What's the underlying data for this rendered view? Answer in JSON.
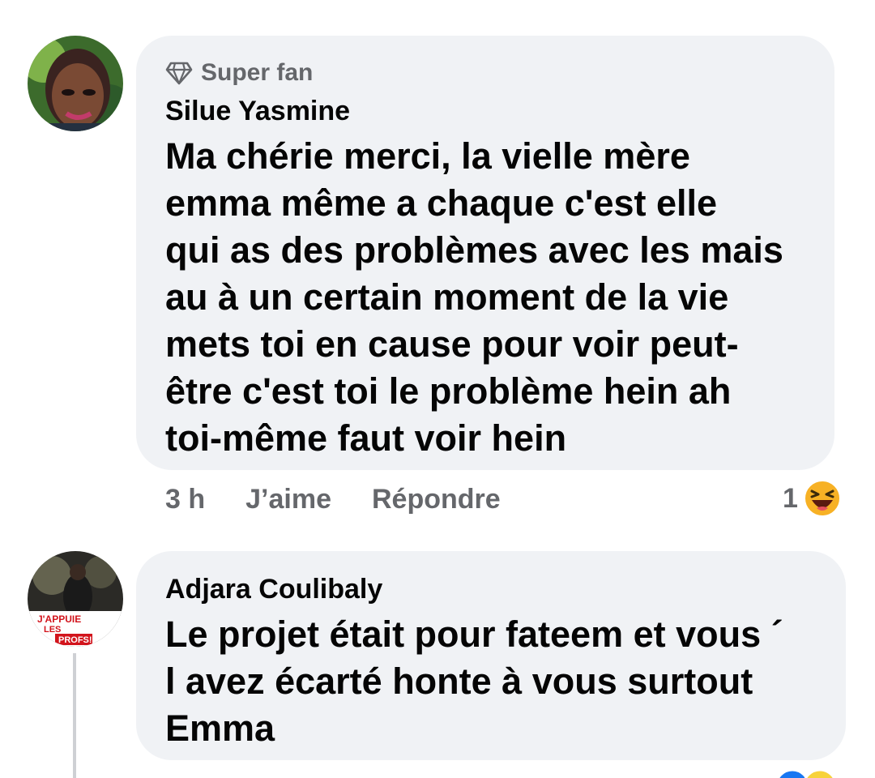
{
  "comments": [
    {
      "badge": "Super fan",
      "author": "Silue Yasmine",
      "text": "Ma chérie merci, la vielle mère\nemma même  a chaque  c'est elle\nqui as des problèmes avec  les mais\nau à un certain moment de la vie\nmets toi en cause pour voir peut-\nêtre c'est  toi le problème hein ah\ntoi-même faut voir hein",
      "time": "3 h",
      "like_label": "J’aime",
      "reply_label": "Répondre",
      "reaction_count": "1",
      "reaction_icon": "laughing-emoji-icon"
    },
    {
      "author": "Adjara Coulibaly",
      "text": "Le projet était pour fateem  et vous ´\nl avez écarté honte à vous surtout\nEmma",
      "avatar_caption_1": "J'APPUIE",
      "avatar_caption_2": "LES",
      "avatar_caption_3": "PROFS!"
    }
  ],
  "colors": {
    "bubble": "#f0f2f5",
    "meta_text": "#65676b",
    "body_text": "#050505",
    "like_blue": "#1877f2",
    "haha_yellow": "#f7b125"
  }
}
